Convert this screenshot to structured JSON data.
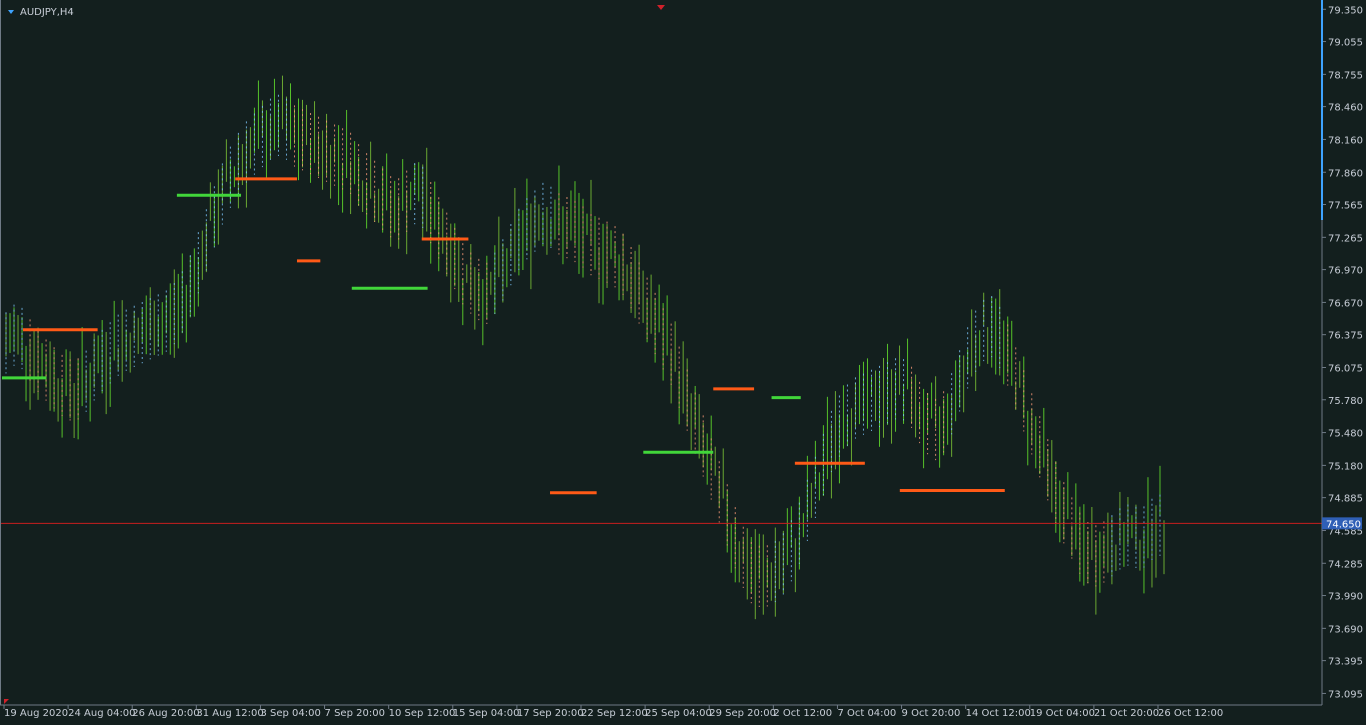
{
  "chart_data": {
    "type": "line",
    "symbol": "AUDJPY,H4",
    "colors": {
      "background": "#131f1e",
      "axis": "#6f7a86",
      "tick_text": "#c7cdd6",
      "bar_up": "#55c12a",
      "bar_down": "#6aa832",
      "upper_stop": "#ff5a17",
      "lower_stop": "#41d63a",
      "cloud_up_fill": "#7fc9ff",
      "cloud_down_fill": "#ff9c7a",
      "current_price_line": "#c81e1e",
      "price_tag_bg": "#2f5fb6",
      "frame": "#3ea3ff"
    },
    "ylim": [
      73.035,
      79.38
    ],
    "y_ticks": [
      "79.350",
      "79.055",
      "78.755",
      "78.460",
      "78.160",
      "77.860",
      "77.565",
      "77.265",
      "76.970",
      "76.670",
      "76.375",
      "76.075",
      "75.780",
      "75.480",
      "75.180",
      "74.885",
      "74.585",
      "74.285",
      "73.990",
      "73.690",
      "73.395",
      "73.095"
    ],
    "x_ticks": [
      "19 Aug 2020",
      "24 Aug 04:00",
      "26 Aug 20:00",
      "31 Aug 12:00",
      "3 Sep 04:00",
      "7 Sep 20:00",
      "10 Sep 12:00",
      "15 Sep 04:00",
      "17 Sep 20:00",
      "22 Sep 12:00",
      "25 Sep 04:00",
      "29 Sep 20:00",
      "2 Oct 12:00",
      "7 Oct 04:00",
      "9 Oct 20:00",
      "14 Oct 12:00",
      "19 Oct 04:00",
      "21 Oct 20:00",
      "26 Oct 12:00"
    ],
    "current_price": 74.65,
    "current_price_label": "74.650",
    "price_bars_close": [
      76.3,
      76.4,
      76.25,
      76.1,
      76.0,
      75.9,
      75.85,
      75.95,
      76.1,
      76.2,
      76.3,
      76.35,
      76.4,
      76.45,
      76.5,
      76.6,
      76.8,
      77.1,
      77.4,
      77.7,
      77.9,
      78.05,
      78.15,
      78.25,
      78.3,
      78.2,
      78.15,
      78.1,
      78.05,
      78.0,
      77.95,
      77.8,
      77.7,
      77.6,
      77.5,
      77.6,
      77.7,
      77.5,
      77.3,
      77.1,
      76.9,
      76.8,
      76.75,
      76.9,
      77.1,
      77.3,
      77.4,
      77.5,
      77.4,
      77.35,
      77.3,
      77.2,
      77.15,
      77.1,
      77.0,
      76.8,
      76.6,
      76.4,
      76.2,
      75.9,
      75.6,
      75.3,
      75.0,
      74.7,
      74.4,
      74.2,
      74.15,
      74.2,
      74.3,
      74.5,
      74.8,
      75.1,
      75.4,
      75.6,
      75.7,
      75.75,
      75.8,
      75.85,
      75.9,
      75.8,
      75.6,
      75.5,
      75.6,
      75.9,
      76.2,
      76.4,
      76.45,
      76.3,
      76.0,
      75.7,
      75.4,
      75.1,
      74.8,
      74.6,
      74.4,
      74.35,
      74.4,
      74.5,
      74.55,
      74.5,
      74.6,
      74.65
    ],
    "upper_stop_line": [
      {
        "x0": 0.0,
        "x1": 0.013,
        "y": null
      },
      {
        "x0": 0.018,
        "x1": 0.082,
        "y": 76.42
      },
      {
        "x0": 0.2,
        "x1": 0.253,
        "y": 77.8
      },
      {
        "x0": 0.253,
        "x1": 0.273,
        "y": 77.05
      },
      {
        "x0": 0.36,
        "x1": 0.4,
        "y": 77.25
      },
      {
        "x0": 0.47,
        "x1": 0.51,
        "y": 74.93
      },
      {
        "x0": 0.61,
        "x1": 0.645,
        "y": 75.88
      },
      {
        "x0": 0.68,
        "x1": 0.74,
        "y": 75.2
      },
      {
        "x0": 0.77,
        "x1": 0.86,
        "y": 74.95
      }
    ],
    "lower_stop_line": [
      {
        "x0": 0.0,
        "x1": 0.038,
        "y": 75.98
      },
      {
        "x0": 0.15,
        "x1": 0.205,
        "y": 77.65
      },
      {
        "x0": 0.3,
        "x1": 0.365,
        "y": 76.8
      },
      {
        "x0": 0.55,
        "x1": 0.61,
        "y": 75.3
      },
      {
        "x0": 0.66,
        "x1": 0.685,
        "y": 75.8
      }
    ]
  }
}
